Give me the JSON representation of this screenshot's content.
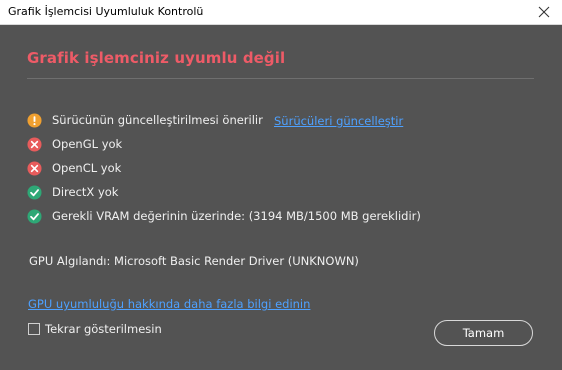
{
  "window": {
    "title": "Grafik İşlemcisi Uyumluluk Kontrolü"
  },
  "dialog": {
    "heading": "Grafik işlemciniz uyumlu değil",
    "checks": [
      {
        "status": "warning",
        "icon": "warning-icon",
        "label": "Sürücünün güncelleştirilmesi önerilir"
      },
      {
        "status": "error",
        "icon": "error-icon",
        "label": "OpenGL yok"
      },
      {
        "status": "error",
        "icon": "error-icon",
        "label": "OpenCL yok"
      },
      {
        "status": "ok",
        "icon": "check-icon",
        "label": "DirectX yok"
      },
      {
        "status": "ok",
        "icon": "check-icon",
        "label": "Gerekli VRAM değerinin üzerinde: (3194 MB/1500 MB gereklidir)"
      }
    ],
    "update_drivers_link": "Sürücüleri güncelleştir",
    "gpu_detected": "GPU Algılandı: Microsoft Basic Render Driver (UNKNOWN)",
    "more_info_link": "GPU uyumluluğu hakkında daha fazla bilgi edinin",
    "dont_show_again": "Tekrar gösterilmesin",
    "dont_show_again_checked": false,
    "ok_button": "Tamam"
  },
  "colors": {
    "background": "#535353",
    "heading": "#ee5b67",
    "link": "#4ea1ff",
    "warning": "#f0a030",
    "error": "#e85c5c",
    "ok": "#2ea876"
  }
}
